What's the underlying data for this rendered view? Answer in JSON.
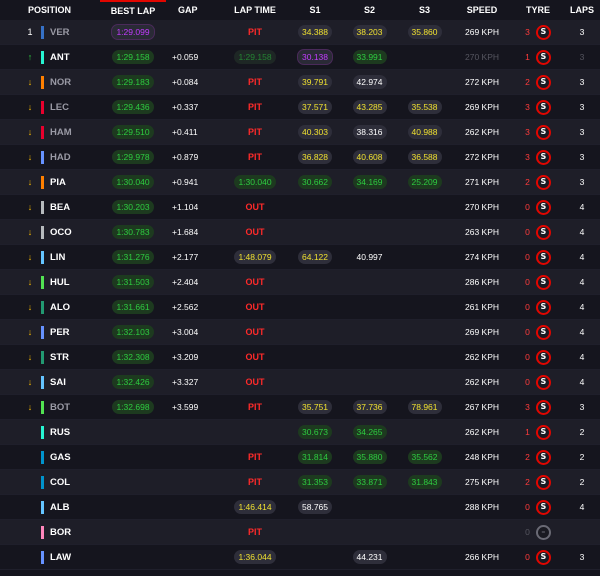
{
  "headers": {
    "position": "POSITION",
    "best_lap": "BEST LAP",
    "gap": "GAP",
    "lap_time": "LAP TIME",
    "s1": "S1",
    "s2": "S2",
    "s3": "S3",
    "speed": "SPEED",
    "tyre": "TYRE",
    "laps": "LAPS"
  },
  "colors": {
    "accent": "#e10600",
    "purple": "#c23cff",
    "green": "#2ecc40",
    "yellow": "#f0e130",
    "pit_red": "#ff2a2a"
  },
  "tyre_icon_label": "S",
  "rows": [
    {
      "ind": "1",
      "ind_type": "num",
      "team": "#3671c6",
      "code": "VER",
      "code_dim": true,
      "best": "1:29.099",
      "best_style": "purple",
      "gap": "",
      "lap": "PIT",
      "lap_type": "status",
      "s1": "34.388",
      "s1_style": "yellow",
      "s2": "38.203",
      "s2_style": "yellow",
      "s3": "35.860",
      "s3_style": "yellow",
      "speed": "269 KPH",
      "speed_dim": false,
      "tyre_n": "3",
      "tyre_grey": false,
      "laps": "3",
      "laps_dim": false
    },
    {
      "ind": "↑",
      "ind_type": "up",
      "team": "#27f4d2",
      "code": "ANT",
      "code_dim": false,
      "best": "1:29.158",
      "best_style": "green",
      "gap": "+0.059",
      "lap": "1:29.158",
      "lap_type": "greendim",
      "s1": "30.138",
      "s1_style": "purple",
      "s2": "33.991",
      "s2_style": "green",
      "s3": "",
      "s3_style": "",
      "speed": "270 KPH",
      "speed_dim": true,
      "tyre_n": "1",
      "tyre_grey": false,
      "laps": "3",
      "laps_dim": true
    },
    {
      "ind": "↓",
      "ind_type": "down",
      "team": "#ff8000",
      "code": "NOR",
      "code_dim": true,
      "best": "1:29.183",
      "best_style": "green",
      "gap": "+0.084",
      "lap": "PIT",
      "lap_type": "status",
      "s1": "39.791",
      "s1_style": "yellow",
      "s2": "42.974",
      "s2_style": "white",
      "s3": "",
      "s3_style": "",
      "speed": "272 KPH",
      "speed_dim": false,
      "tyre_n": "2",
      "tyre_grey": false,
      "laps": "3",
      "laps_dim": false
    },
    {
      "ind": "↓",
      "ind_type": "down",
      "team": "#e8002d",
      "code": "LEC",
      "code_dim": true,
      "best": "1:29.436",
      "best_style": "green",
      "gap": "+0.337",
      "lap": "PIT",
      "lap_type": "status",
      "s1": "37.571",
      "s1_style": "yellow",
      "s2": "43.285",
      "s2_style": "yellow",
      "s3": "35.538",
      "s3_style": "yellow",
      "speed": "269 KPH",
      "speed_dim": false,
      "tyre_n": "3",
      "tyre_grey": false,
      "laps": "3",
      "laps_dim": false
    },
    {
      "ind": "↓",
      "ind_type": "down",
      "team": "#e8002d",
      "code": "HAM",
      "code_dim": true,
      "best": "1:29.510",
      "best_style": "green",
      "gap": "+0.411",
      "lap": "PIT",
      "lap_type": "status",
      "s1": "40.303",
      "s1_style": "yellow",
      "s2": "38.316",
      "s2_style": "white",
      "s3": "40.988",
      "s3_style": "yellow",
      "speed": "262 KPH",
      "speed_dim": false,
      "tyre_n": "3",
      "tyre_grey": false,
      "laps": "3",
      "laps_dim": false
    },
    {
      "ind": "↓",
      "ind_type": "down",
      "team": "#6692ff",
      "code": "HAD",
      "code_dim": true,
      "best": "1:29.978",
      "best_style": "green",
      "gap": "+0.879",
      "lap": "PIT",
      "lap_type": "status",
      "s1": "36.828",
      "s1_style": "yellow",
      "s2": "40.608",
      "s2_style": "yellow",
      "s3": "36.588",
      "s3_style": "yellow",
      "speed": "272 KPH",
      "speed_dim": false,
      "tyre_n": "3",
      "tyre_grey": false,
      "laps": "3",
      "laps_dim": false
    },
    {
      "ind": "↓",
      "ind_type": "down",
      "team": "#ff8000",
      "code": "PIA",
      "code_dim": false,
      "best": "1:30.040",
      "best_style": "green",
      "gap": "+0.941",
      "lap": "1:30.040",
      "lap_type": "green",
      "s1": "30.662",
      "s1_style": "green",
      "s2": "34.169",
      "s2_style": "green",
      "s3": "25.209",
      "s3_style": "green",
      "speed": "271 KPH",
      "speed_dim": false,
      "tyre_n": "2",
      "tyre_grey": false,
      "laps": "3",
      "laps_dim": false
    },
    {
      "ind": "↓",
      "ind_type": "down",
      "team": "#b6babd",
      "code": "BEA",
      "code_dim": false,
      "best": "1:30.203",
      "best_style": "green",
      "gap": "+1.104",
      "lap": "OUT",
      "lap_type": "status",
      "s1": "",
      "s1_style": "",
      "s2": "",
      "s2_style": "",
      "s3": "",
      "s3_style": "",
      "speed": "270 KPH",
      "speed_dim": false,
      "tyre_n": "0",
      "tyre_grey": false,
      "laps": "4",
      "laps_dim": false
    },
    {
      "ind": "↓",
      "ind_type": "down",
      "team": "#b6babd",
      "code": "OCO",
      "code_dim": false,
      "best": "1:30.783",
      "best_style": "green",
      "gap": "+1.684",
      "lap": "OUT",
      "lap_type": "status",
      "s1": "",
      "s1_style": "",
      "s2": "",
      "s2_style": "",
      "s3": "",
      "s3_style": "",
      "speed": "263 KPH",
      "speed_dim": false,
      "tyre_n": "0",
      "tyre_grey": false,
      "laps": "4",
      "laps_dim": false
    },
    {
      "ind": "↓",
      "ind_type": "down",
      "team": "#64c4ff",
      "code": "LIN",
      "code_dim": false,
      "best": "1:31.276",
      "best_style": "green",
      "gap": "+2.177",
      "lap": "1:48.079",
      "lap_type": "yellow",
      "s1": "64.122",
      "s1_style": "yellow",
      "s2": "40.997",
      "s2_style": "",
      "s3": "",
      "s3_style": "",
      "speed": "274 KPH",
      "speed_dim": false,
      "tyre_n": "0",
      "tyre_grey": false,
      "laps": "4",
      "laps_dim": false
    },
    {
      "ind": "↓",
      "ind_type": "down",
      "team": "#52e252",
      "code": "HUL",
      "code_dim": false,
      "best": "1:31.503",
      "best_style": "green",
      "gap": "+2.404",
      "lap": "OUT",
      "lap_type": "status",
      "s1": "",
      "s1_style": "",
      "s2": "",
      "s2_style": "",
      "s3": "",
      "s3_style": "",
      "speed": "286 KPH",
      "speed_dim": false,
      "tyre_n": "0",
      "tyre_grey": false,
      "laps": "4",
      "laps_dim": false
    },
    {
      "ind": "↓",
      "ind_type": "down",
      "team": "#229971",
      "code": "ALO",
      "code_dim": false,
      "best": "1:31.661",
      "best_style": "green",
      "gap": "+2.562",
      "lap": "OUT",
      "lap_type": "status",
      "s1": "",
      "s1_style": "",
      "s2": "",
      "s2_style": "",
      "s3": "",
      "s3_style": "",
      "speed": "261 KPH",
      "speed_dim": false,
      "tyre_n": "0",
      "tyre_grey": false,
      "laps": "4",
      "laps_dim": false
    },
    {
      "ind": "↓",
      "ind_type": "down",
      "team": "#6692ff",
      "code": "PER",
      "code_dim": false,
      "best": "1:32.103",
      "best_style": "green",
      "gap": "+3.004",
      "lap": "OUT",
      "lap_type": "status",
      "s1": "",
      "s1_style": "",
      "s2": "",
      "s2_style": "",
      "s3": "",
      "s3_style": "",
      "speed": "269 KPH",
      "speed_dim": false,
      "tyre_n": "0",
      "tyre_grey": false,
      "laps": "4",
      "laps_dim": false
    },
    {
      "ind": "↓",
      "ind_type": "down",
      "team": "#229971",
      "code": "STR",
      "code_dim": false,
      "best": "1:32.308",
      "best_style": "green",
      "gap": "+3.209",
      "lap": "OUT",
      "lap_type": "status",
      "s1": "",
      "s1_style": "",
      "s2": "",
      "s2_style": "",
      "s3": "",
      "s3_style": "",
      "speed": "262 KPH",
      "speed_dim": false,
      "tyre_n": "0",
      "tyre_grey": false,
      "laps": "4",
      "laps_dim": false
    },
    {
      "ind": "↓",
      "ind_type": "down",
      "team": "#64c4ff",
      "code": "SAI",
      "code_dim": false,
      "best": "1:32.426",
      "best_style": "green",
      "gap": "+3.327",
      "lap": "OUT",
      "lap_type": "status",
      "s1": "",
      "s1_style": "",
      "s2": "",
      "s2_style": "",
      "s3": "",
      "s3_style": "",
      "speed": "262 KPH",
      "speed_dim": false,
      "tyre_n": "0",
      "tyre_grey": false,
      "laps": "4",
      "laps_dim": false
    },
    {
      "ind": "↓",
      "ind_type": "down",
      "team": "#52e252",
      "code": "BOT",
      "code_dim": true,
      "best": "1:32.698",
      "best_style": "green",
      "gap": "+3.599",
      "lap": "PIT",
      "lap_type": "status",
      "s1": "35.751",
      "s1_style": "yellow",
      "s2": "37.736",
      "s2_style": "yellow",
      "s3": "78.961",
      "s3_style": "yellow",
      "speed": "267 KPH",
      "speed_dim": false,
      "tyre_n": "3",
      "tyre_grey": false,
      "laps": "3",
      "laps_dim": false
    },
    {
      "ind": "",
      "ind_type": "none",
      "team": "#27f4d2",
      "code": "RUS",
      "code_dim": false,
      "best": "",
      "best_style": "",
      "gap": "",
      "lap": "",
      "lap_type": "none",
      "s1": "30.673",
      "s1_style": "green",
      "s2": "34.265",
      "s2_style": "green",
      "s3": "",
      "s3_style": "",
      "speed": "262 KPH",
      "speed_dim": false,
      "tyre_n": "1",
      "tyre_grey": false,
      "laps": "2",
      "laps_dim": false
    },
    {
      "ind": "",
      "ind_type": "none",
      "team": "#0093cc",
      "code": "GAS",
      "code_dim": false,
      "best": "",
      "best_style": "",
      "gap": "",
      "lap": "PIT",
      "lap_type": "status",
      "s1": "31.814",
      "s1_style": "green",
      "s2": "35.880",
      "s2_style": "green",
      "s3": "35.562",
      "s3_style": "green",
      "speed": "248 KPH",
      "speed_dim": false,
      "tyre_n": "2",
      "tyre_grey": false,
      "laps": "2",
      "laps_dim": false
    },
    {
      "ind": "",
      "ind_type": "none",
      "team": "#0093cc",
      "code": "COL",
      "code_dim": false,
      "best": "",
      "best_style": "",
      "gap": "",
      "lap": "PIT",
      "lap_type": "status",
      "s1": "31.353",
      "s1_style": "green",
      "s2": "33.871",
      "s2_style": "green",
      "s3": "31.843",
      "s3_style": "green",
      "speed": "275 KPH",
      "speed_dim": false,
      "tyre_n": "2",
      "tyre_grey": false,
      "laps": "2",
      "laps_dim": false
    },
    {
      "ind": "",
      "ind_type": "none",
      "team": "#64c4ff",
      "code": "ALB",
      "code_dim": false,
      "best": "",
      "best_style": "",
      "gap": "",
      "lap": "1:46.414",
      "lap_type": "yellow",
      "s1": "58.765",
      "s1_style": "white",
      "s2": "",
      "s2_style": "",
      "s3": "",
      "s3_style": "",
      "speed": "288 KPH",
      "speed_dim": false,
      "tyre_n": "0",
      "tyre_grey": false,
      "laps": "4",
      "laps_dim": false
    },
    {
      "ind": "",
      "ind_type": "none",
      "team": "#ff87bc",
      "code": "BOR",
      "code_dim": false,
      "best": "",
      "best_style": "",
      "gap": "",
      "lap": "PIT",
      "lap_type": "status",
      "s1": "",
      "s1_style": "",
      "s2": "",
      "s2_style": "",
      "s3": "",
      "s3_style": "",
      "speed": "",
      "speed_dim": false,
      "tyre_n": "0",
      "tyre_grey": true,
      "laps": "",
      "laps_dim": false
    },
    {
      "ind": "",
      "ind_type": "none",
      "team": "#6692ff",
      "code": "LAW",
      "code_dim": false,
      "best": "",
      "best_style": "",
      "gap": "",
      "lap": "1:36.044",
      "lap_type": "yellow",
      "s1": "",
      "s1_style": "",
      "s2": "44.231",
      "s2_style": "white",
      "s3": "",
      "s3_style": "",
      "speed": "266 KPH",
      "speed_dim": false,
      "tyre_n": "0",
      "tyre_grey": false,
      "laps": "3",
      "laps_dim": false
    }
  ]
}
